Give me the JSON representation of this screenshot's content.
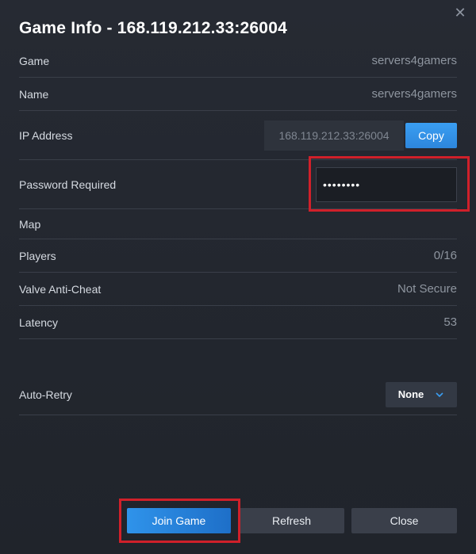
{
  "dialog": {
    "title": "Game Info - 168.119.212.33:26004",
    "close_glyph": "✕"
  },
  "rows": {
    "game": {
      "label": "Game",
      "value": "servers4gamers"
    },
    "name": {
      "label": "Name",
      "value": "servers4gamers"
    },
    "ip": {
      "label": "IP Address",
      "value": "168.119.212.33:26004",
      "copy_label": "Copy"
    },
    "password": {
      "label": "Password Required",
      "value": "••••••••"
    },
    "map": {
      "label": "Map",
      "value": ""
    },
    "players": {
      "label": "Players",
      "value": "0/16"
    },
    "vac": {
      "label": "Valve Anti-Cheat",
      "value": "Not Secure"
    },
    "latency": {
      "label": "Latency",
      "value": "53"
    },
    "auto_retry": {
      "label": "Auto-Retry",
      "selected": "None"
    }
  },
  "buttons": {
    "join": "Join Game",
    "refresh": "Refresh",
    "close": "Close"
  },
  "colors": {
    "accent": "#2f93ea",
    "highlight": "#d0202a",
    "background": "#23272f"
  }
}
